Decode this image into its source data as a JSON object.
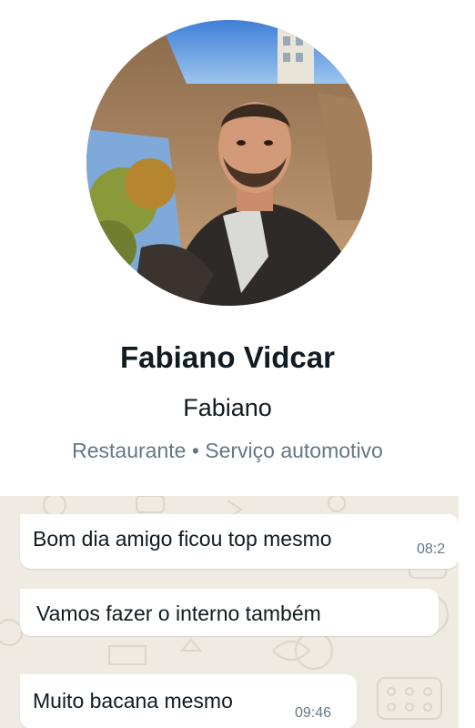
{
  "profile": {
    "name": "Fabiano Vidcar",
    "display_name": "Fabiano",
    "categories": "Restaurante • Serviço automotivo"
  },
  "messages": [
    {
      "text": "Bom dia amigo ficou top mesmo",
      "time": "08:2"
    },
    {
      "text": "Vamos fazer o interno também",
      "time": ""
    },
    {
      "text": "Muito bacana mesmo",
      "time": "09:46"
    }
  ],
  "colors": {
    "chat_background": "#efeae2",
    "bubble": "#ffffff",
    "primary_text": "#111b21",
    "secondary_text": "#667781"
  }
}
